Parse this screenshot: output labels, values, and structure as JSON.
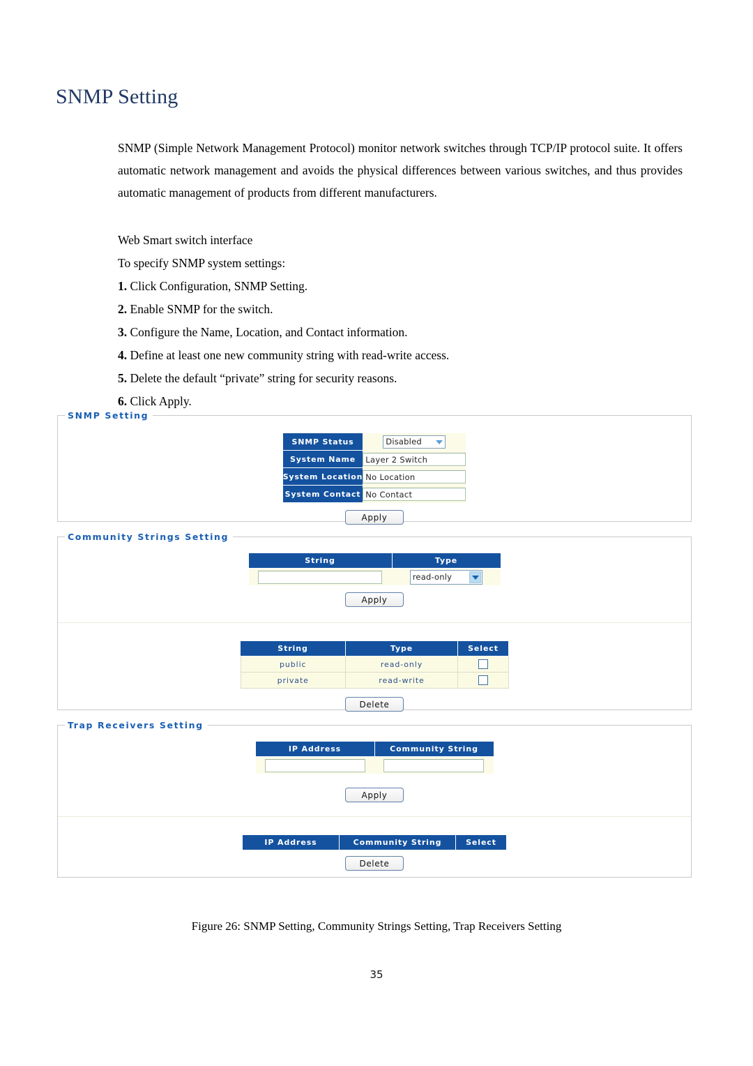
{
  "document": {
    "title": "SNMP Setting",
    "intro_paragraph": "SNMP (Simple Network Management Protocol) monitor network switches through TCP/IP protocol suite. It offers automatic network management and avoids the physical differences between various switches, and thus provides automatic management of products from different manufacturers.",
    "subheading_1": "Web Smart switch interface",
    "subheading_2": "To specify SNMP system settings:",
    "steps": [
      {
        "num": "1.",
        "text": "Click Configuration, SNMP Setting."
      },
      {
        "num": "2.",
        "text": "Enable SNMP for the switch."
      },
      {
        "num": "3.",
        "text": "Configure the Name, Location, and Contact information."
      },
      {
        "num": "4.",
        "text": "Define at least one new community string with read-write access."
      },
      {
        "num": "5.",
        "text": "Delete the default “private” string for security reasons."
      },
      {
        "num": "6.",
        "text": "Click Apply."
      }
    ],
    "figure_caption": "Figure 26: SNMP Setting, Community Strings Setting, Trap Receivers Setting",
    "page_number": "35"
  },
  "colors": {
    "title_blue": "#1f3864",
    "legend_blue": "#1a5fb4",
    "header_blue": "#14529f",
    "row_cream": "#fbfbe4",
    "field_cream": "#fbfbe8",
    "table_text_blue": "#2b4f8a"
  },
  "snmp_setting_panel": {
    "legend": "SNMP Setting",
    "rows": [
      {
        "label": "SNMP Status",
        "type": "select",
        "value": "Disabled"
      },
      {
        "label": "System Name",
        "type": "text",
        "value": "Layer 2 Switch"
      },
      {
        "label": "System Location",
        "type": "text",
        "value": "No Location"
      },
      {
        "label": "System Contact",
        "type": "text",
        "value": "No Contact"
      }
    ],
    "apply_label": "Apply"
  },
  "community_strings_panel": {
    "legend": "Community Strings Setting",
    "entry_headers": [
      "String",
      "Type"
    ],
    "entry_string_value": "",
    "entry_type_value": "read-only",
    "apply_label": "Apply",
    "list_headers": [
      "String",
      "Type",
      "Select"
    ],
    "list_rows": [
      {
        "string": "public",
        "type": "read-only",
        "selected": false
      },
      {
        "string": "private",
        "type": "read-write",
        "selected": false
      }
    ],
    "delete_label": "Delete"
  },
  "trap_receivers_panel": {
    "legend": "Trap Receivers Setting",
    "entry_headers": [
      "IP Address",
      "Community String"
    ],
    "entry_ip_value": "",
    "entry_community_value": "",
    "apply_label": "Apply",
    "list_headers": [
      "IP Address",
      "Community String",
      "Select"
    ],
    "list_rows": [],
    "delete_label": "Delete"
  }
}
